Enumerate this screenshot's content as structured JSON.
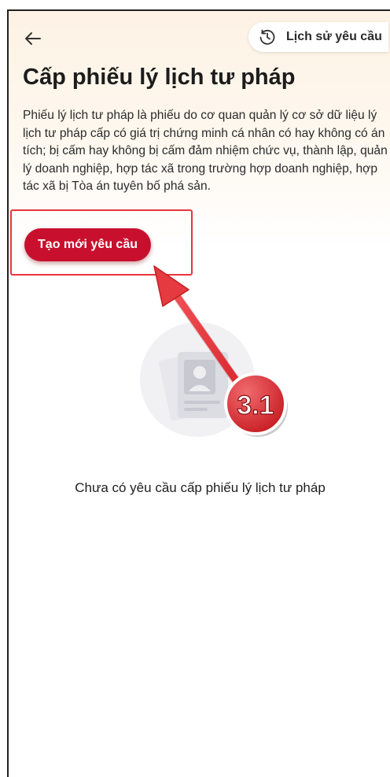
{
  "header": {
    "back_icon": "arrow-left-icon",
    "history_icon": "clock-history-icon",
    "history_label": "Lịch sử yêu cầu"
  },
  "page": {
    "title": "Cấp phiếu lý lịch tư pháp",
    "description": "Phiếu lý lịch tư pháp là phiếu do cơ quan quản lý cơ sở dữ liệu lý lịch tư pháp cấp có giá trị chứng minh cá nhân có hay không có án tích; bị cấm hay không bị cấm đảm nhiệm chức vụ, thành lập, quản lý doanh nghiệp, hợp tác xã trong trường hợp doanh nghiệp, hợp tác xã bị Tòa án tuyên bố phá sản.",
    "create_button_label": "Tạo mới yêu cầu"
  },
  "empty_state": {
    "icon": "id-card-icon",
    "message": "Chưa có yêu cầu cấp phiếu lý lịch tư pháp"
  },
  "annotation": {
    "step_label": "3.1",
    "colors": {
      "accent": "#e8353c",
      "button": "#c8102e"
    }
  }
}
